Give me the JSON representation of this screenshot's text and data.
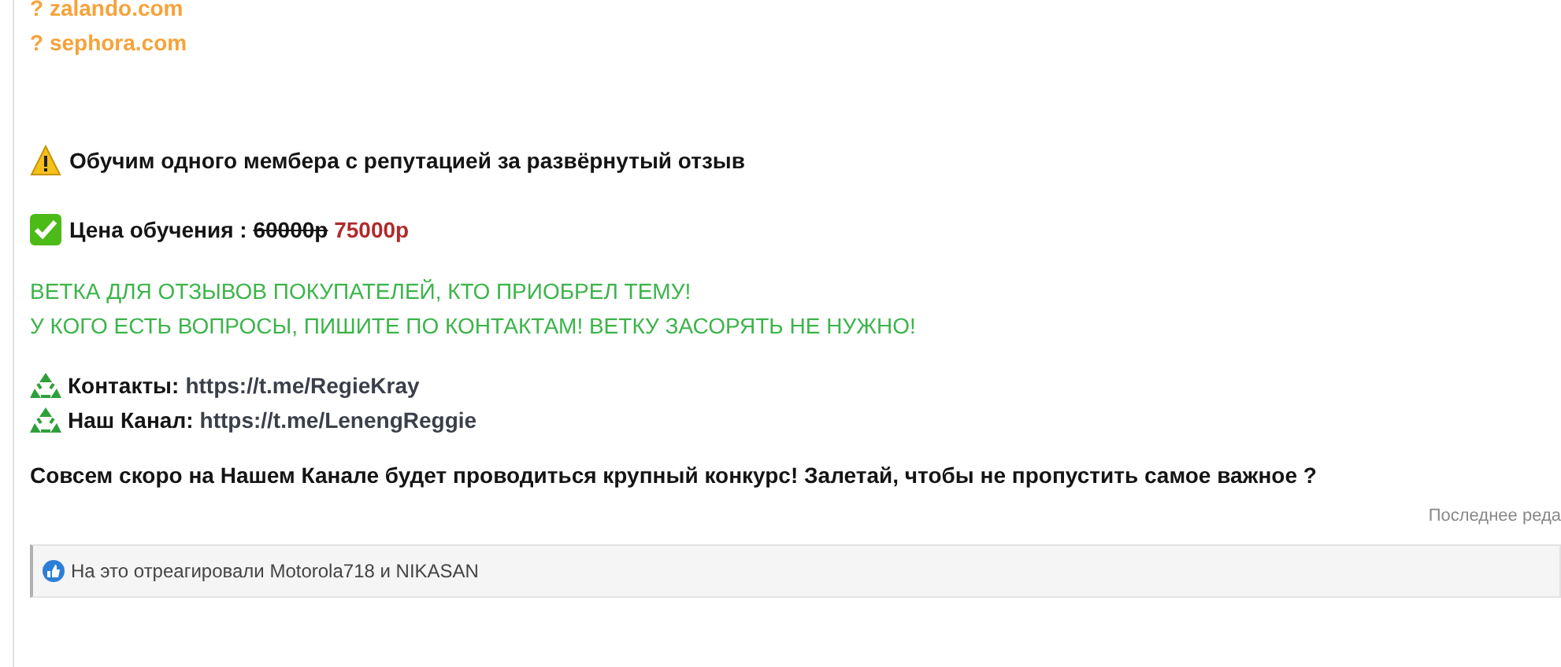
{
  "links": [
    {
      "mark": "?",
      "text": "zalando.com"
    },
    {
      "mark": "?",
      "text": "sephora.com"
    }
  ],
  "notice": {
    "text": "Обучим одного мембера с репутацией за развёрнутый отзыв"
  },
  "price": {
    "label": "Цена обучения :",
    "old_price": "60000р",
    "new_price": "75000р"
  },
  "green_lines": [
    "ВЕТКА ДЛЯ ОТЗЫВОВ ПОКУПАТЕЛЕЙ, КТО ПРИОБРЕЛ ТЕМУ!",
    "У КОГО ЕСТЬ ВОПРОСЫ, ПИШИТЕ ПО КОНТАКТАМ! ВЕТКУ ЗАСОРЯТЬ НЕ НУЖНО!"
  ],
  "contacts": [
    {
      "label": "Контакты:",
      "url": "https://t.me/RegieKray"
    },
    {
      "label": "Наш Канал:",
      "url": "https://t.me/LenengReggie"
    }
  ],
  "announcement": "Совсем скоро на Нашем Канале будет проводиться крупный конкурс! Залетай, чтобы не пропустить самое важное ?",
  "last_edit": "Последнее реда",
  "reactions": {
    "text": "На это отреагировали Motorola718 и NIKASAN"
  }
}
